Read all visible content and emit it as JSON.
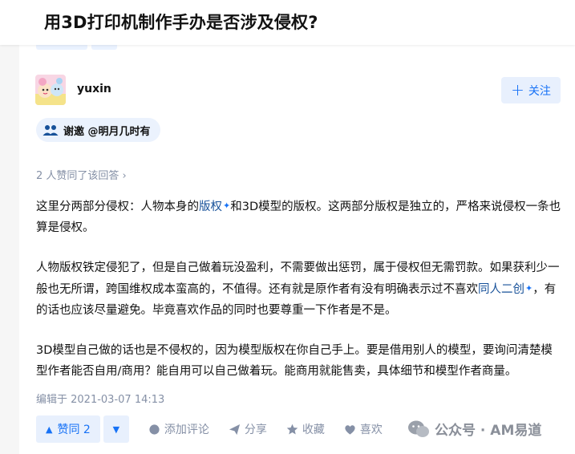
{
  "question": {
    "title": "用3D打印机制作手办是否涉及侵权?"
  },
  "author": {
    "name": "yuxin",
    "follow_label": "关注",
    "avatar_icon": "cartoon-avatar"
  },
  "invite": {
    "label": "谢邀 @明月几时有"
  },
  "upvote_summary": "2 人赞同了该回答 ›",
  "content": {
    "p1": {
      "a": "这里分两部分侵权：人物本身的",
      "link1": "版权",
      "b": "和3D模型的版权。这两部分版权是独立的，严格来说侵权一条也算是侵权。"
    },
    "p2": {
      "a": "人物版权铁定侵犯了，但是自己做着玩没盈利，不需要做出惩罚，属于侵权但无需罚款。如果获利少一般也无所谓，跨国维权成本蛮高的，不值得。还有就是原作者有没有明确表示过不喜欢",
      "link1": "同人二创",
      "b": "，有的话也应该尽量避免。毕竟喜欢作品的同时也要尊重一下作者是不是。"
    },
    "p3": "3D模型自己做的话也是不侵权的，因为模型版权在你自己手上。要是借用别人的模型，要询问清楚模型作者能否自用/商用？能自用可以自己做着玩。能商用就能售卖，具体细节和模型作者商量。"
  },
  "edit_time": "编辑于 2021-03-07 14:13",
  "actions": {
    "upvote": "赞同 2",
    "comment": "添加评论",
    "share": "分享",
    "collect": "收藏",
    "like": "喜欢"
  },
  "watermark": {
    "text": "公众号 · AM易道"
  },
  "colors": {
    "accent": "#1772f6",
    "muted": "#8590a6",
    "link": "#175199",
    "button_bg": "#e8f0fd"
  }
}
